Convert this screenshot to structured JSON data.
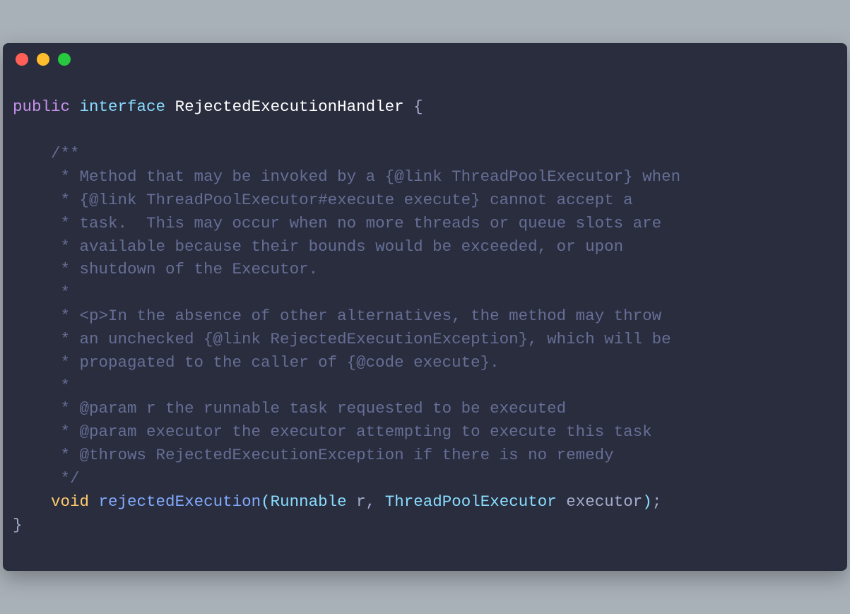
{
  "titlebar": {
    "dots": [
      "red",
      "yellow",
      "green"
    ]
  },
  "code": {
    "l1_public": "public",
    "l1_interface": "interface",
    "l1_class": "RejectedExecutionHandler",
    "l1_brace": "{",
    "c1": "    /**",
    "c2": "     * Method that may be invoked by a {@link ThreadPoolExecutor} when",
    "c3": "     * {@link ThreadPoolExecutor#execute execute} cannot accept a",
    "c4": "     * task.  This may occur when no more threads or queue slots are",
    "c5": "     * available because their bounds would be exceeded, or upon",
    "c6": "     * shutdown of the Executor.",
    "c7": "     *",
    "c8": "     * <p>In the absence of other alternatives, the method may throw",
    "c9": "     * an unchecked {@link RejectedExecutionException}, which will be",
    "c10": "     * propagated to the caller of {@code execute}.",
    "c11": "     *",
    "c12": "     * @param r the runnable task requested to be executed",
    "c13": "     * @param executor the executor attempting to execute this task",
    "c14": "     * @throws RejectedExecutionException if there is no remedy",
    "c15": "     */",
    "sig_indent": "    ",
    "sig_void": "void",
    "sig_method": "rejectedExecution",
    "sig_type1": "Runnable",
    "sig_param1": "r",
    "sig_comma": ",",
    "sig_type2": "ThreadPoolExecutor",
    "sig_param2": "executor",
    "sig_semicolon": ";",
    "close_brace": "}"
  }
}
